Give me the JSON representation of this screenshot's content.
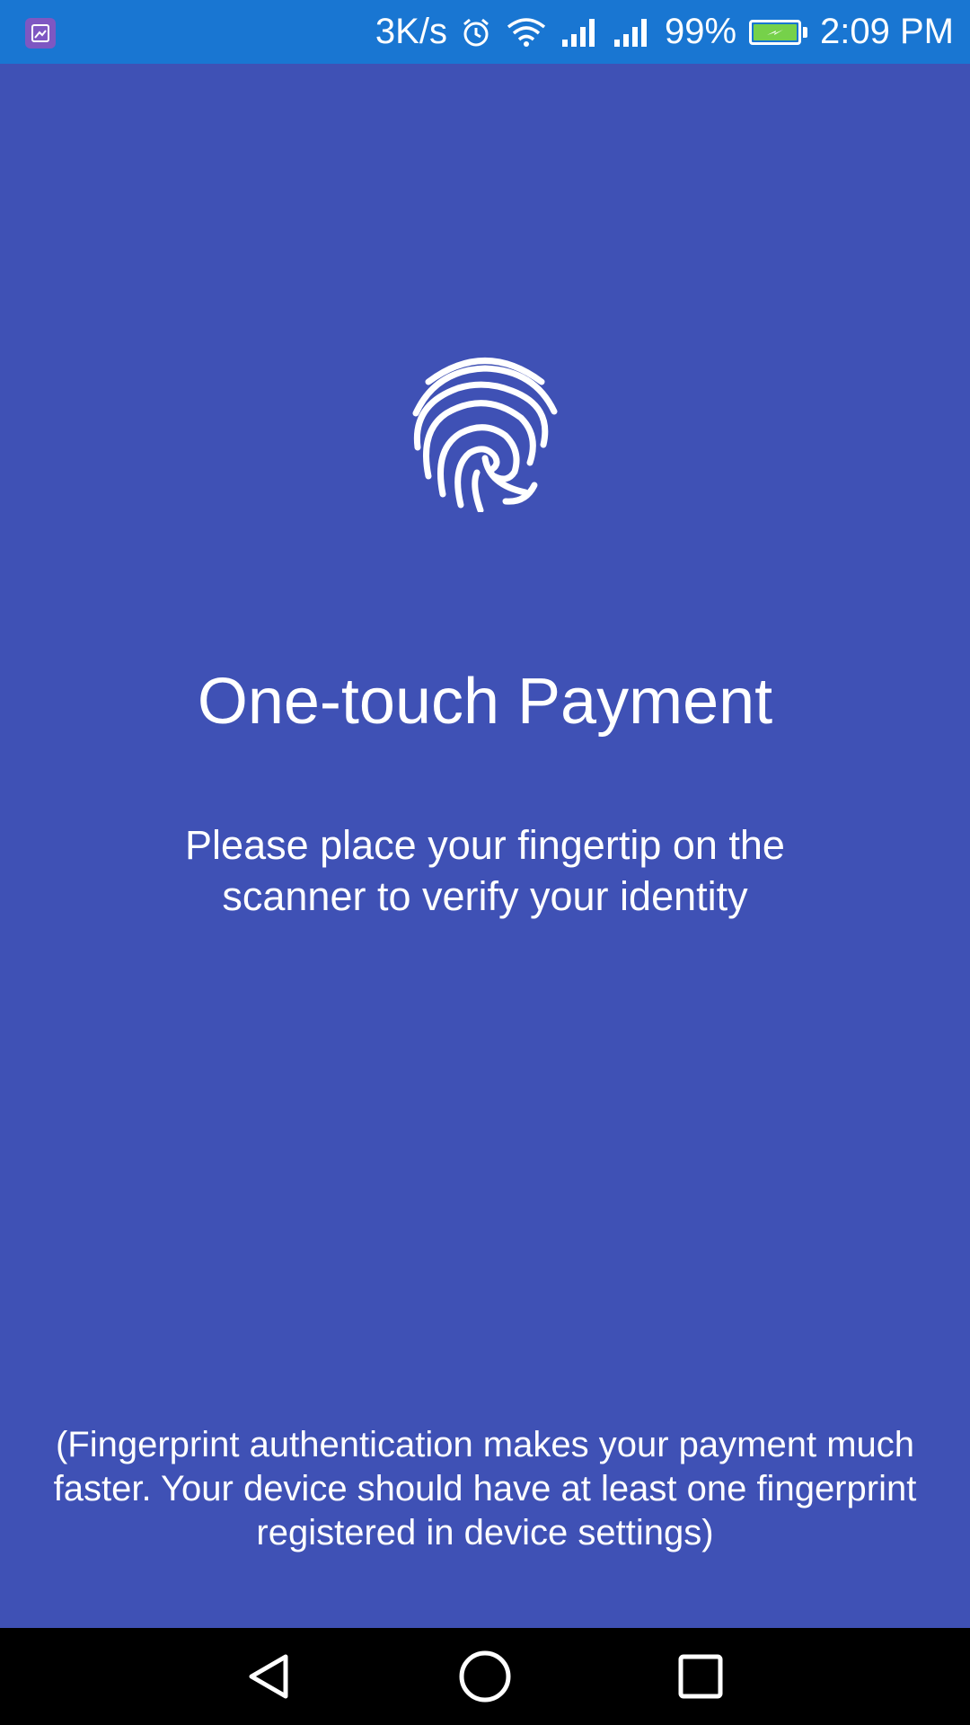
{
  "status_bar": {
    "network_speed": "3K/s",
    "battery_percent": "99%",
    "time": "2:09 PM",
    "icons": [
      "gallery-icon",
      "alarm-icon",
      "wifi-icon",
      "signal-icon",
      "signal-icon",
      "battery-charging-icon"
    ]
  },
  "main": {
    "icon": "fingerprint-icon",
    "title": "One-touch Payment",
    "instruction": "Please place your fingertip on the scanner to verify your identity",
    "footnote": "(Fingerprint authentication makes your payment much faster. Your device should have at least one fingerprint registered in device settings)"
  },
  "nav_bar": {
    "icons": [
      "back-icon",
      "home-icon",
      "recent-apps-icon"
    ]
  },
  "colors": {
    "background": "#3F51B5",
    "status_bar": "#1976D2",
    "nav_bar": "#000000",
    "text": "#FFFFFF",
    "battery_fill": "#76D14A"
  }
}
